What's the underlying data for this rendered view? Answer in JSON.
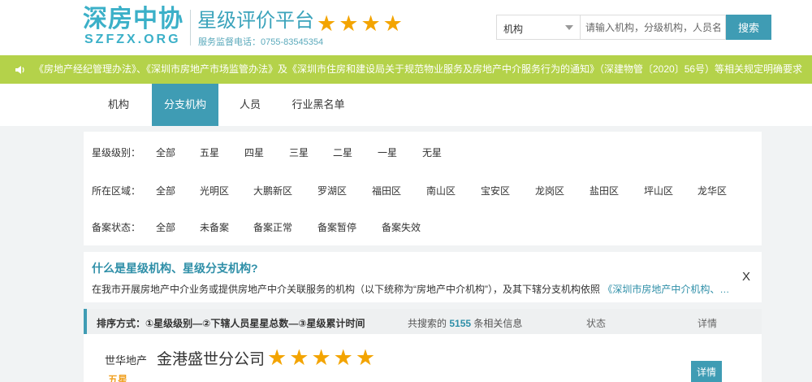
{
  "header": {
    "logo_cn": "深房中协",
    "logo_en": "SZFZX.ORG",
    "site_title": "星级评价平台",
    "hotline": "服务监督电话：0755-83545354",
    "title_stars": [
      "★",
      "★",
      "★",
      "★"
    ],
    "star_color": "#f3a400"
  },
  "search": {
    "select_value": "机构",
    "placeholder": "请输入机构，分级机构，人员名",
    "button_label": "搜索"
  },
  "notice": {
    "icon": "speaker-icon",
    "text": "《房地产经纪管理办法》、《深圳市房地产市场监管办法》及《深圳市住房和建设局关于规范物业服务及房地产中介服务行为的通知》（深建物管〔2020〕56号）等相关规定明确要求"
  },
  "tabs": [
    {
      "label": "机构",
      "active": false
    },
    {
      "label": "分支机构",
      "active": true
    },
    {
      "label": "人员",
      "active": false
    },
    {
      "label": "行业黑名单",
      "active": false
    }
  ],
  "filters": {
    "star": {
      "label": "星级级别：",
      "options": [
        "全部",
        "五星",
        "四星",
        "三星",
        "二星",
        "一星",
        "无星"
      ]
    },
    "region": {
      "label": "所在区域：",
      "options": [
        "全部",
        "光明区",
        "大鹏新区",
        "罗湖区",
        "福田区",
        "南山区",
        "宝安区",
        "龙岗区",
        "盐田区",
        "坪山区",
        "龙华区"
      ]
    },
    "record": {
      "label": "备案状态：",
      "options": [
        "全部",
        "未备案",
        "备案正常",
        "备案暂停",
        "备案失效"
      ]
    }
  },
  "info": {
    "title": "什么是星级机构、星级分支机构?",
    "text": "在我市开展房地产中介业务或提供房地产中介关联服务的机构（以下统称为“房地产中介机构”），及其下辖分支机构依照",
    "link": "《深圳市房地产中介机构、…",
    "close": "X"
  },
  "sort": {
    "label": "排序方式：①星级级别—②下辖人员星星总数—③星级累计时间",
    "count_prefix": "共搜索的",
    "count": "5155",
    "count_suffix": "条相关信息",
    "status": "状态",
    "detail": "详情"
  },
  "results": [
    {
      "brand": "世华地产",
      "name": "金港盛世分公司",
      "stars": [
        "★",
        "★",
        "★",
        "★",
        "★"
      ],
      "level": "五星",
      "button": "详情"
    }
  ],
  "colors": {
    "accent": "#3f9cb4",
    "notice_bg": "#b4d24a",
    "star": "#f3a400"
  }
}
